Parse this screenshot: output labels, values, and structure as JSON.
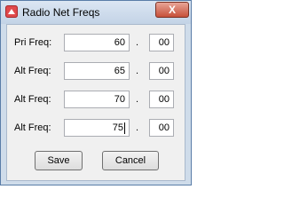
{
  "window": {
    "title": "Radio Net Freqs",
    "close_glyph": "X"
  },
  "form": {
    "separator": ".",
    "rows": [
      {
        "label": "Pri Freq:",
        "integer": "60",
        "decimal": "00"
      },
      {
        "label": "Alt Freq:",
        "integer": "65",
        "decimal": "00"
      },
      {
        "label": "Alt Freq:",
        "integer": "70",
        "decimal": "00"
      },
      {
        "label": "Alt Freq:",
        "integer": "75",
        "decimal": "00"
      }
    ]
  },
  "buttons": {
    "save": "Save",
    "cancel": "Cancel"
  }
}
